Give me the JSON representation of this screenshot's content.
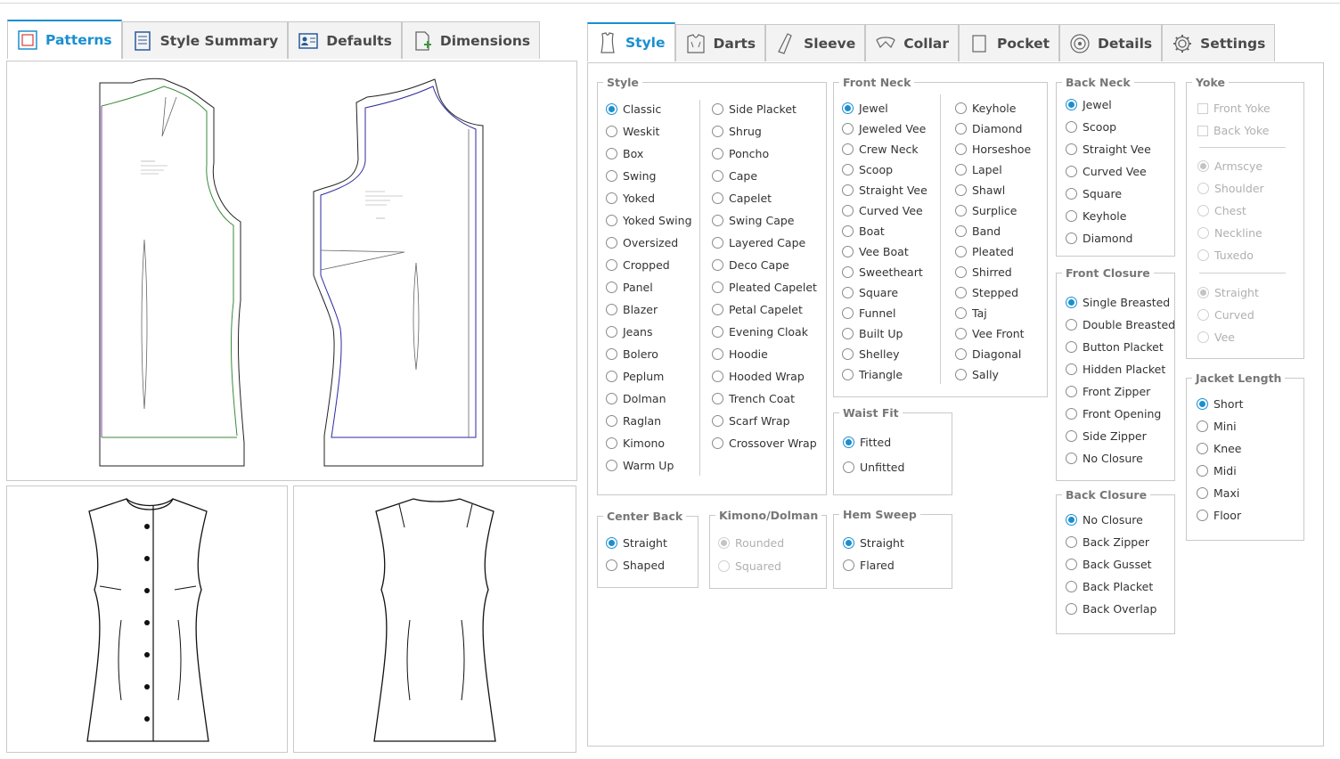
{
  "left_tabs": [
    {
      "label": "Patterns",
      "icon": "pattern-icon",
      "active": true
    },
    {
      "label": "Style Summary",
      "icon": "summary-icon",
      "active": false
    },
    {
      "label": "Defaults",
      "icon": "defaults-icon",
      "active": false
    },
    {
      "label": "Dimensions",
      "icon": "dimensions-icon",
      "active": false
    }
  ],
  "right_tabs": [
    {
      "label": "Style",
      "icon": "bodice-icon",
      "active": true
    },
    {
      "label": "Darts",
      "icon": "darts-icon",
      "active": false
    },
    {
      "label": "Sleeve",
      "icon": "sleeve-icon",
      "active": false
    },
    {
      "label": "Collar",
      "icon": "collar-icon",
      "active": false
    },
    {
      "label": "Pocket",
      "icon": "pocket-icon",
      "active": false
    },
    {
      "label": "Details",
      "icon": "details-icon",
      "active": false
    },
    {
      "label": "Settings",
      "icon": "gear-icon",
      "active": false
    }
  ],
  "groups": {
    "style": {
      "legend": "Style",
      "col1": [
        "Classic",
        "Weskit",
        "Box",
        "Swing",
        "Yoked",
        "Yoked Swing",
        "Oversized",
        "Cropped",
        "Panel",
        "Blazer",
        "Jeans",
        "Bolero",
        "Peplum",
        "Dolman",
        "Raglan",
        "Kimono",
        "Warm Up"
      ],
      "col2": [
        "Side Placket",
        "Shrug",
        "Poncho",
        "Cape",
        "Capelet",
        "Swing Cape",
        "Layered Cape",
        "Deco Cape",
        "Pleated Capelet",
        "Petal Capelet",
        "Evening Cloak",
        "Hoodie",
        "Hooded Wrap",
        "Trench Coat",
        "Scarf Wrap",
        "Crossover Wrap"
      ],
      "selected": "Classic"
    },
    "front_neck": {
      "legend": "Front Neck",
      "col1": [
        "Jewel",
        "Jeweled Vee",
        "Crew Neck",
        "Scoop",
        "Straight Vee",
        "Curved Vee",
        "Boat",
        "Vee Boat",
        "Sweetheart",
        "Square",
        "Funnel",
        "Built Up",
        "Shelley",
        "Triangle"
      ],
      "col2": [
        "Keyhole",
        "Diamond",
        "Horseshoe",
        "Lapel",
        "Shawl",
        "Surplice",
        "Band",
        "Pleated",
        "Shirred",
        "Stepped",
        "Taj",
        "Vee Front",
        "Diagonal",
        "Sally"
      ],
      "selected": "Jewel"
    },
    "back_neck": {
      "legend": "Back Neck",
      "options": [
        "Jewel",
        "Scoop",
        "Straight Vee",
        "Curved Vee",
        "Square",
        "Keyhole",
        "Diamond"
      ],
      "selected": "Jewel"
    },
    "yoke": {
      "legend": "Yoke",
      "checks": [
        "Front Yoke",
        "Back Yoke"
      ],
      "group1": [
        "Armscye",
        "Shoulder",
        "Chest",
        "Neckline",
        "Tuxedo"
      ],
      "group1_selected": "Armscye",
      "group2": [
        "Straight",
        "Curved",
        "Vee"
      ],
      "group2_selected": "Straight"
    },
    "front_closure": {
      "legend": "Front Closure",
      "options": [
        "Single Breasted",
        "Double Breasted",
        "Button Placket",
        "Hidden Placket",
        "Front Zipper",
        "Front Opening",
        "Side Zipper",
        "No Closure"
      ],
      "selected": "Single Breasted"
    },
    "back_closure": {
      "legend": "Back Closure",
      "options": [
        "No Closure",
        "Back Zipper",
        "Back Gusset",
        "Back Placket",
        "Back Overlap"
      ],
      "selected": "No Closure"
    },
    "jacket_length": {
      "legend": "Jacket Length",
      "options": [
        "Short",
        "Mini",
        "Knee",
        "Midi",
        "Maxi",
        "Floor"
      ],
      "selected": "Short"
    },
    "waist_fit": {
      "legend": "Waist Fit",
      "options": [
        "Fitted",
        "Unfitted"
      ],
      "selected": "Fitted"
    },
    "center_back": {
      "legend": "Center Back",
      "options": [
        "Straight",
        "Shaped"
      ],
      "selected": "Straight"
    },
    "kimono_dolman": {
      "legend": "Kimono/Dolman",
      "options": [
        "Rounded",
        "Squared"
      ],
      "selected": "Rounded"
    },
    "hem_sweep": {
      "legend": "Hem Sweep",
      "options": [
        "Straight",
        "Flared"
      ],
      "selected": "Straight"
    }
  },
  "colors": {
    "accent": "#1a8fd0",
    "front_seam": "#3a8a3a",
    "back_seam": "#2a2aa0"
  }
}
